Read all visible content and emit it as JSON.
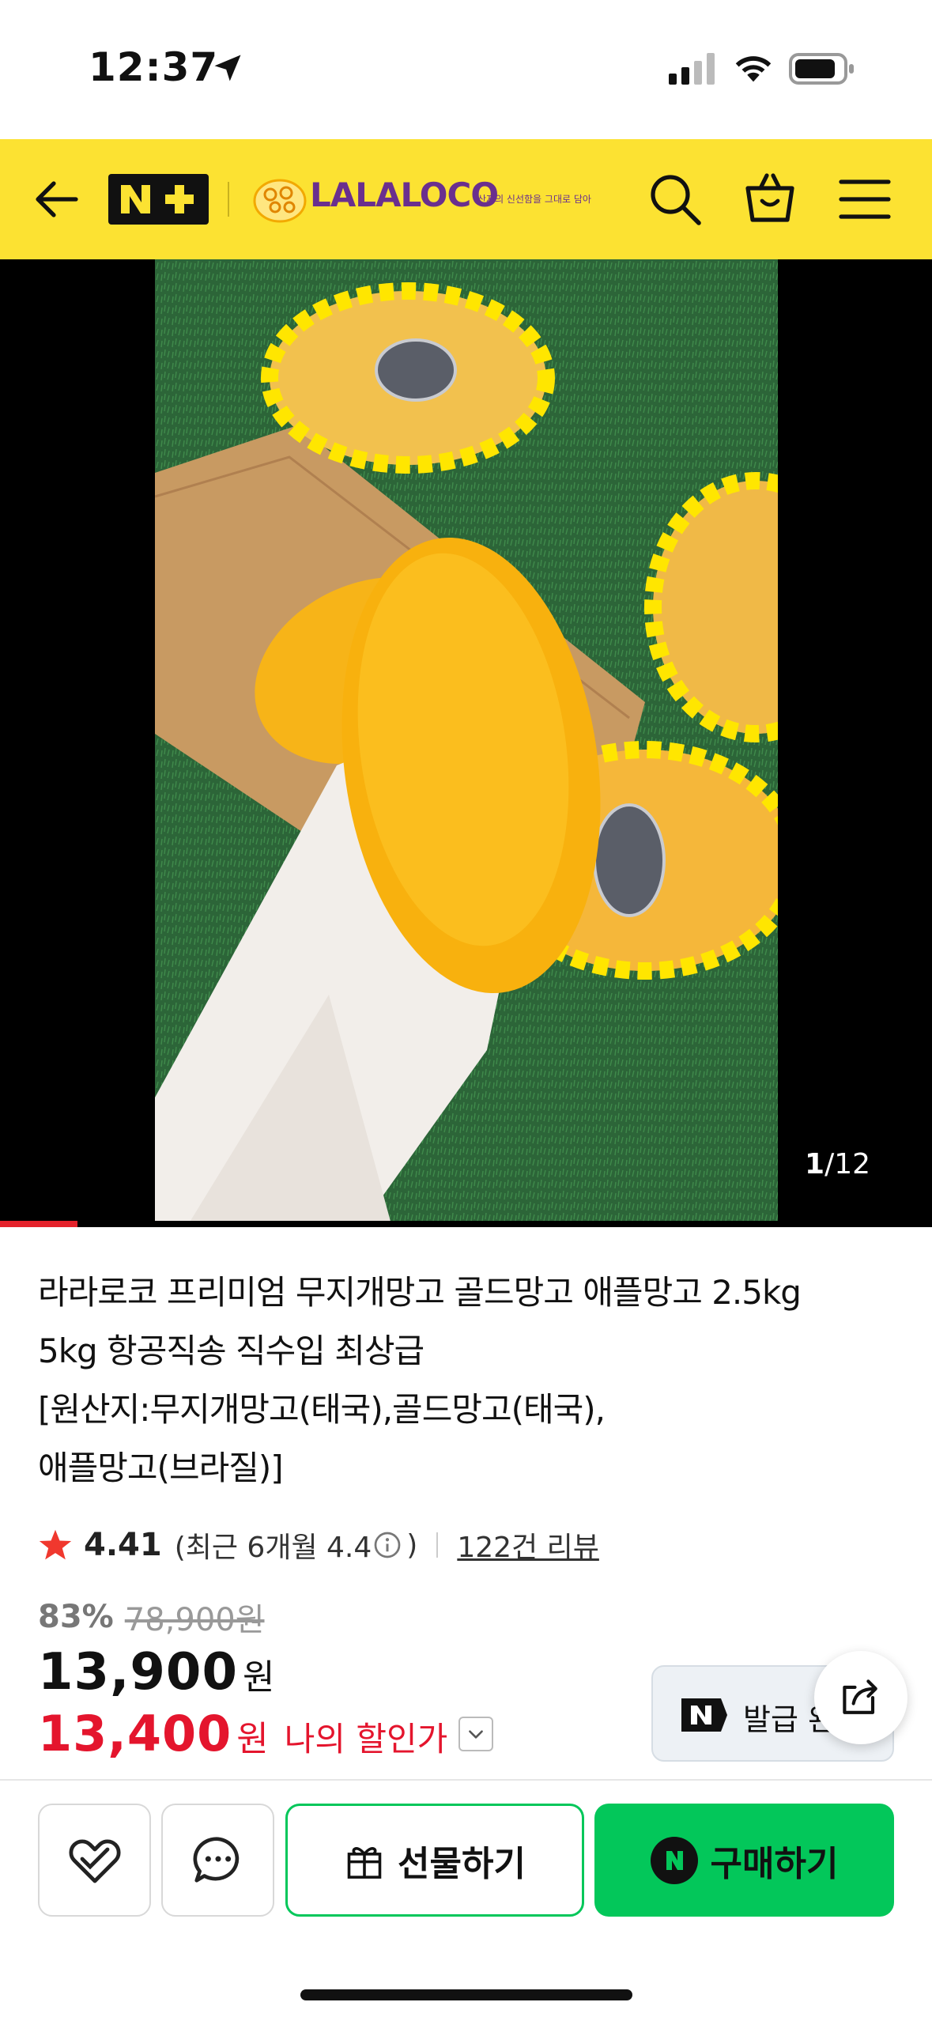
{
  "status_bar": {
    "time": "12:37"
  },
  "header": {
    "nplus_label": "N+",
    "brand_name": "LALALOCO",
    "brand_tagline": "산지의 신선함을 그대로 담아",
    "accent_color": "#FCE232"
  },
  "media": {
    "current": "1",
    "total": "/12",
    "progress_fraction": 0.083
  },
  "product": {
    "title_lines": [
      "라라로코 프리미엄 무지개망고 골드망고 애플망고 2.5kg",
      "5kg 항공직송 직수입 최상급",
      "[원산지:무지개망고(태국),골드망고(태국),",
      "애플망고(브라질)]"
    ],
    "rating": "4.41",
    "rating_recent": "(최근 6개월 4.4",
    "rating_recent_close": ")",
    "review_link": "122건 리뷰",
    "discount_rate": "83%",
    "original_price": "78,900원",
    "price": "13,900",
    "price_unit": "원",
    "my_price": "13,400",
    "my_price_unit": "원",
    "my_price_label": "나의 할인가"
  },
  "coupon": {
    "label": "발급 완료"
  },
  "bottom_bar": {
    "gift_label": "선물하기",
    "buy_label": "구매하기",
    "buy_color": "#03C75A"
  }
}
